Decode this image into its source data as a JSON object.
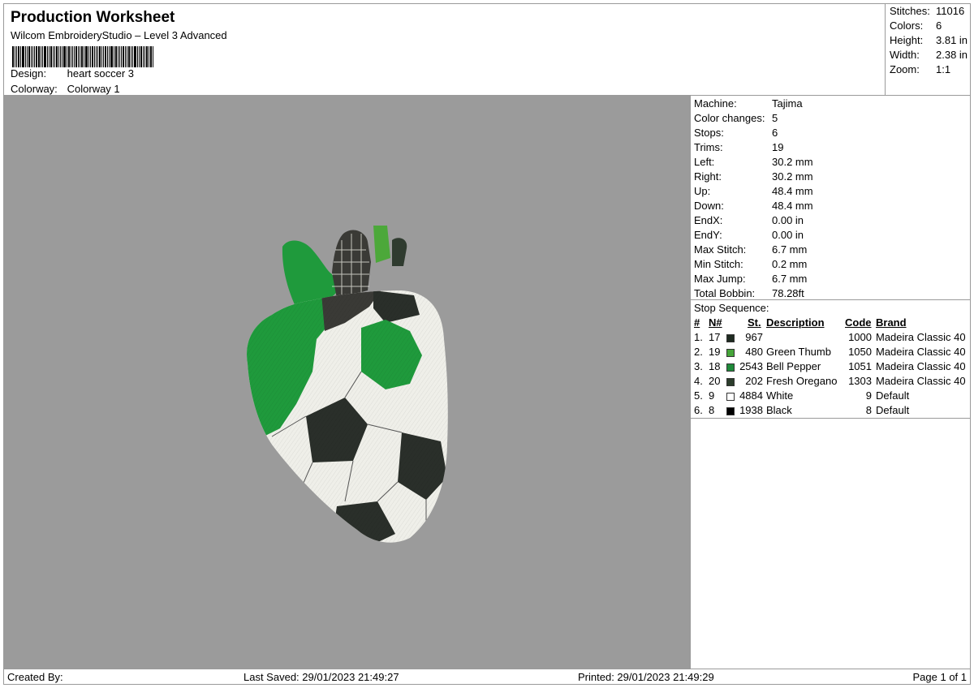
{
  "header": {
    "title": "Production Worksheet",
    "subtitle": "Wilcom EmbroideryStudio – Level 3 Advanced",
    "design_label": "Design:",
    "design_value": "heart soccer 3",
    "colorway_label": "Colorway:",
    "colorway_value": "Colorway 1"
  },
  "stats": [
    {
      "label": "Stitches:",
      "value": "11016"
    },
    {
      "label": "Colors:",
      "value": "6"
    },
    {
      "label": "Height:",
      "value": "3.81 in"
    },
    {
      "label": "Width:",
      "value": "2.38 in"
    },
    {
      "label": "Zoom:",
      "value": "1:1"
    }
  ],
  "machine": [
    {
      "label": "Machine:",
      "value": "Tajima"
    },
    {
      "label": "Color changes:",
      "value": "5"
    },
    {
      "label": "Stops:",
      "value": "6"
    },
    {
      "label": "Trims:",
      "value": "19"
    },
    {
      "label": "Left:",
      "value": "30.2 mm"
    },
    {
      "label": "Right:",
      "value": "30.2 mm"
    },
    {
      "label": "Up:",
      "value": "48.4 mm"
    },
    {
      "label": "Down:",
      "value": "48.4 mm"
    },
    {
      "label": "EndX:",
      "value": "0.00 in"
    },
    {
      "label": "EndY:",
      "value": "0.00 in"
    },
    {
      "label": "Max Stitch:",
      "value": "6.7 mm"
    },
    {
      "label": "Min Stitch:",
      "value": "0.2 mm"
    },
    {
      "label": "Max Jump:",
      "value": "6.7 mm"
    },
    {
      "label": "Total Bobbin:",
      "value": "78.28ft"
    }
  ],
  "stop_sequence": {
    "title": "Stop Sequence:",
    "headers": {
      "num": "#",
      "n": "N#",
      "st": "St.",
      "description": "Description",
      "code": "Code",
      "brand": "Brand"
    },
    "rows": [
      {
        "num": "1.",
        "n": "17",
        "color": "#1f2b22",
        "st": "967",
        "description": "",
        "code": "1000",
        "brand": "Madeira Classic 40"
      },
      {
        "num": "2.",
        "n": "19",
        "color": "#46a53a",
        "st": "480",
        "description": "Green Thumb",
        "code": "1050",
        "brand": "Madeira Classic 40"
      },
      {
        "num": "3.",
        "n": "18",
        "color": "#1f8a3a",
        "st": "2543",
        "description": "Bell Pepper",
        "code": "1051",
        "brand": "Madeira Classic 40"
      },
      {
        "num": "4.",
        "n": "20",
        "color": "#2c3d2c",
        "st": "202",
        "description": "Fresh Oregano",
        "code": "1303",
        "brand": "Madeira Classic 40"
      },
      {
        "num": "5.",
        "n": "9",
        "color": "#ffffff",
        "st": "4884",
        "description": "White",
        "code": "9",
        "brand": "Default"
      },
      {
        "num": "6.",
        "n": "8",
        "color": "#000000",
        "st": "1938",
        "description": "Black",
        "code": "8",
        "brand": "Default"
      }
    ]
  },
  "footer": {
    "created_by": "Created By:",
    "last_saved": "Last Saved: 29/01/2023 21:49:27",
    "printed": "Printed: 29/01/2023 21:49:29",
    "page": "Page 1 of 1"
  },
  "colors": {
    "canvas_bg": "#9b9b9b",
    "green": "#1f9a3c",
    "dark": "#2a2f2a",
    "white": "#efefe9"
  }
}
